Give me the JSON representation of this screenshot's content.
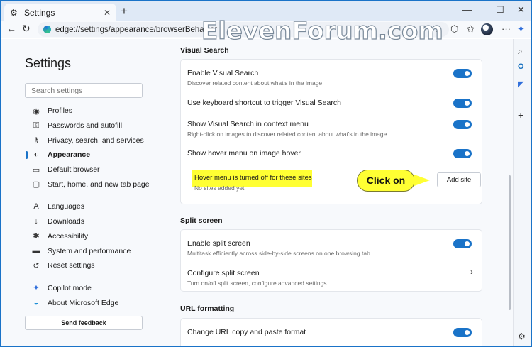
{
  "tab": {
    "title": "Settings",
    "close": "✕"
  },
  "window_controls": {
    "minimize": "—",
    "maximize": "☐",
    "close": "✕"
  },
  "address": {
    "url": "edge://settings/appearance/browserBehavior"
  },
  "watermark": "ElevenForum.com",
  "sidebar": {
    "title": "Settings",
    "search_placeholder": "Search settings",
    "items": [
      {
        "label": "Profiles",
        "icon": "profile-icon"
      },
      {
        "label": "Passwords and autofill",
        "icon": "key-icon"
      },
      {
        "label": "Privacy, search, and services",
        "icon": "lock-icon"
      },
      {
        "label": "Appearance",
        "icon": "palette-icon"
      },
      {
        "label": "Default browser",
        "icon": "browser-icon"
      },
      {
        "label": "Start, home, and new tab page",
        "icon": "home-icon"
      },
      {
        "label": "Languages",
        "icon": "language-icon"
      },
      {
        "label": "Downloads",
        "icon": "download-icon"
      },
      {
        "label": "Accessibility",
        "icon": "accessibility-icon"
      },
      {
        "label": "System and performance",
        "icon": "laptop-icon"
      },
      {
        "label": "Reset settings",
        "icon": "reset-icon"
      },
      {
        "label": "Copilot mode",
        "icon": "copilot-icon"
      },
      {
        "label": "About Microsoft Edge",
        "icon": "edge-icon"
      }
    ],
    "feedback": "Send feedback"
  },
  "visual_search": {
    "title": "Visual Search",
    "enable": {
      "title": "Enable Visual Search",
      "desc": "Discover related content about what's in the image"
    },
    "shortcut": {
      "title": "Use keyboard shortcut to trigger Visual Search"
    },
    "context": {
      "title": "Show Visual Search in context menu",
      "desc": "Right-click on images to discover related content about what's in the image"
    },
    "hover": {
      "title": "Show hover menu on image hover"
    },
    "sites": {
      "title": "Hover menu is turned off for these sites",
      "empty": "No sites added yet",
      "button": "Add site"
    }
  },
  "split_screen": {
    "title": "Split screen",
    "enable": {
      "title": "Enable split screen",
      "desc": "Multitask efficiently across side-by-side screens on one browsing tab."
    },
    "configure": {
      "title": "Configure split screen",
      "desc": "Turn on/off split screen, configure advanced settings."
    }
  },
  "url_formatting": {
    "title": "URL formatting",
    "copy": {
      "title": "Change URL copy and paste format"
    }
  },
  "callout": "Click on",
  "colors": {
    "accent": "#1a73c8",
    "highlight": "#ffff33"
  }
}
